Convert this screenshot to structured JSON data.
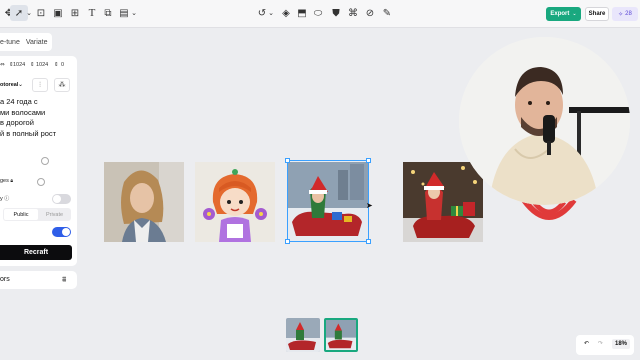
{
  "toolbar": {
    "icons": [
      "move-icon",
      "select-tool-icon",
      "chevron-down-icon",
      "frame-icon",
      "image-icon",
      "text-icon",
      "upload-icon",
      "mockup-icon",
      "chevron-down-icon",
      "lasso-icon",
      "eraser-icon",
      "inpaint-icon",
      "vectorize-icon",
      "tshirt-icon",
      "repaint-icon",
      "style-icon",
      "magic-edit-icon"
    ],
    "export_label": "Export",
    "share_label": "Share",
    "credits": "28"
  },
  "left_panel": {
    "tabs": [
      "e-tune",
      "Variate"
    ],
    "dims": {
      "a": "1024",
      "b": "1024",
      "c": "0"
    },
    "style_label": "otoreal",
    "prompt": "а 24 года с\nми волосами\nв дорогой\nй в полный рост",
    "option_images_label": "ges",
    "option_y_label": "y",
    "visibility": {
      "public": "Public",
      "private": "Private"
    },
    "recraft_label": "Recraft",
    "colors_label": "ors"
  },
  "zoom": {
    "percent": "18%"
  },
  "colors": {
    "accent_green": "#19a87f",
    "selection_blue": "#3aa0ff",
    "toggle_blue": "#2f5ee8",
    "credits_purple": "#5a46d6"
  }
}
